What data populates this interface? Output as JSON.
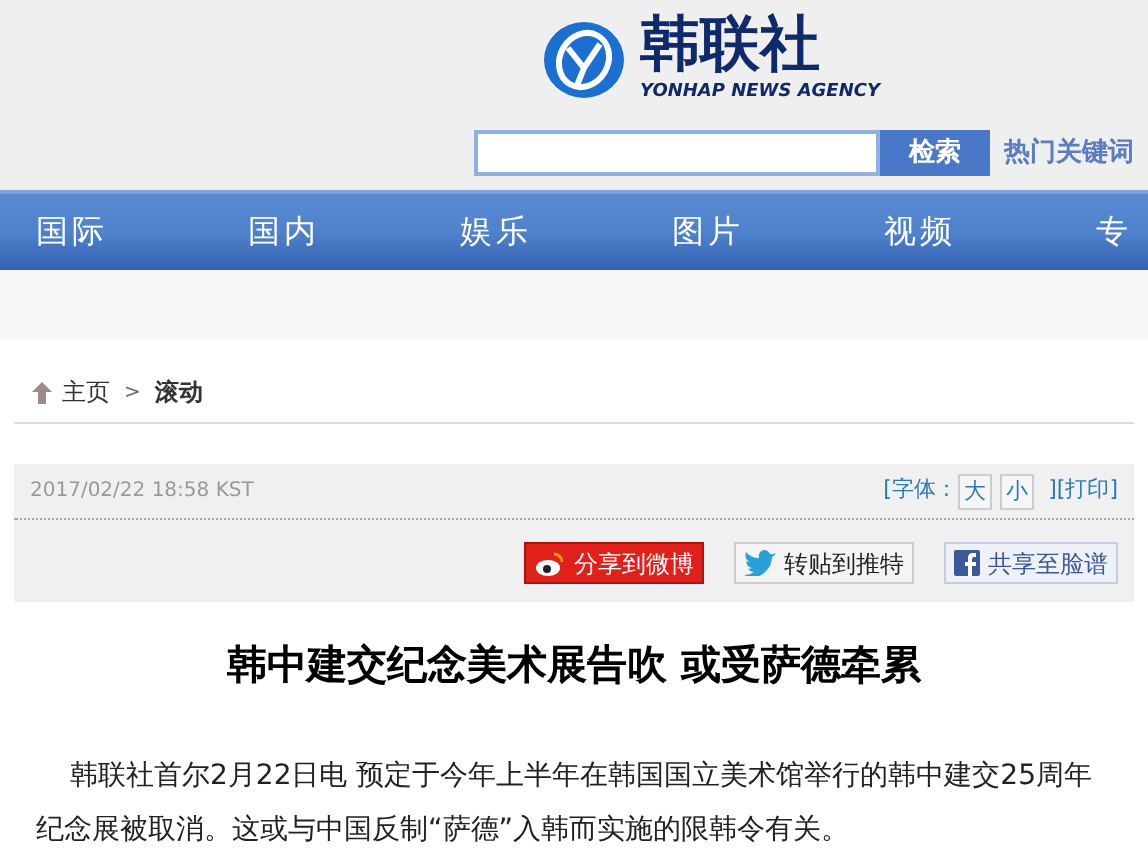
{
  "header": {
    "logo_name": "韩联社",
    "logo_subtitle": "YONHAP NEWS AGENCY",
    "search_button": "检索",
    "hot_keywords": "热门关键词"
  },
  "nav": [
    {
      "label": "国际"
    },
    {
      "label": "国内"
    },
    {
      "label": "娱乐"
    },
    {
      "label": "图片"
    },
    {
      "label": "视频"
    },
    {
      "label": "专"
    }
  ],
  "breadcrumb": [
    "主页",
    "滚动"
  ],
  "breadcrumb_separator": ">",
  "article": {
    "timestamp": "2017/02/22 18:58 KST",
    "font_label": "[字体 :",
    "font_large": "大",
    "font_small": "小",
    "print": "][打印]",
    "share": [
      {
        "kind": "weibo",
        "label": "分享到微博"
      },
      {
        "kind": "twitter",
        "label": "转贴到推特"
      },
      {
        "kind": "facebook",
        "label": "共享至脸谱"
      }
    ],
    "title": "韩中建交纪念美术展告吹 或受萨德牵累",
    "body": "韩联社首尔2月22日电 预定于今年上半年在韩国国立美术馆举行的韩中建交25周年纪念展被取消。这或与中国反制“萨德”入韩而实施的限韩令有关。"
  }
}
